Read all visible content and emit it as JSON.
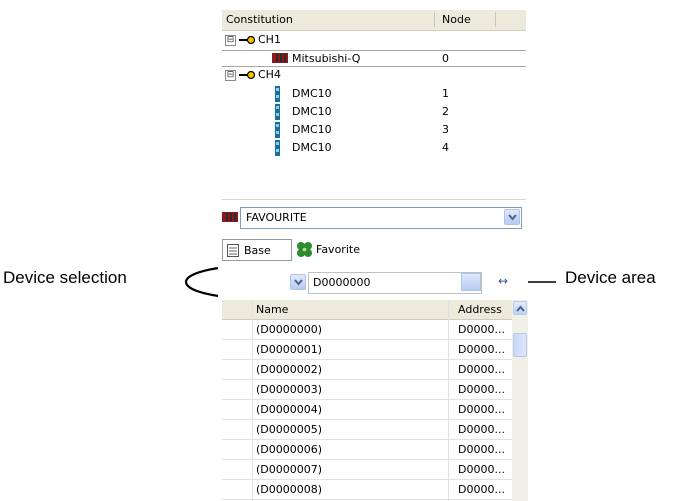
{
  "tree": {
    "columns": [
      "Constitution",
      "Node"
    ],
    "rows": [
      {
        "kind": "channel",
        "label": "CH1",
        "node": "",
        "expander": "⊟",
        "icon": "key-icon"
      },
      {
        "kind": "plc",
        "label": "Mitsubishi-Q",
        "node": "0",
        "icon": "plc-icon"
      },
      {
        "kind": "channel",
        "label": "CH4",
        "node": "",
        "expander": "⊟",
        "icon": "key-icon"
      },
      {
        "kind": "device",
        "label": "DMC10",
        "node": "1",
        "icon": "dmc-icon"
      },
      {
        "kind": "device",
        "label": "DMC10",
        "node": "2",
        "icon": "dmc-icon"
      },
      {
        "kind": "device",
        "label": "DMC10",
        "node": "3",
        "icon": "dmc-icon"
      },
      {
        "kind": "device",
        "label": "DMC10",
        "node": "4",
        "icon": "dmc-icon"
      }
    ]
  },
  "plc_selector": {
    "value": "FAVOURITE",
    "ellipsis_label": "..."
  },
  "tabs": [
    {
      "label": "Base",
      "icon": "list-icon"
    },
    {
      "label": "Favorite",
      "icon": "clover-icon"
    }
  ],
  "device_selector": {
    "value": "D"
  },
  "device_area": {
    "value": "D0000000",
    "arrows_label": "↔"
  },
  "grid": {
    "columns": [
      "Name",
      "Address"
    ],
    "rows": [
      {
        "name": "(D0000000)",
        "address": "D0000..."
      },
      {
        "name": "(D0000001)",
        "address": "D0000..."
      },
      {
        "name": "(D0000002)",
        "address": "D0000..."
      },
      {
        "name": "(D0000003)",
        "address": "D0000..."
      },
      {
        "name": "(D0000004)",
        "address": "D0000..."
      },
      {
        "name": "(D0000005)",
        "address": "D0000..."
      },
      {
        "name": "(D0000006)",
        "address": "D0000..."
      },
      {
        "name": "(D0000007)",
        "address": "D0000..."
      },
      {
        "name": "(D0000008)",
        "address": "D0000..."
      }
    ]
  },
  "annotations": {
    "device_selection": "Device selection",
    "device_area": "Device area"
  },
  "colors": {
    "accent_blue": "#3a78d8",
    "plc_red": "#8b1a1a",
    "dmc_teal": "#1a6e9a",
    "clover_green": "#2e8b2e"
  }
}
